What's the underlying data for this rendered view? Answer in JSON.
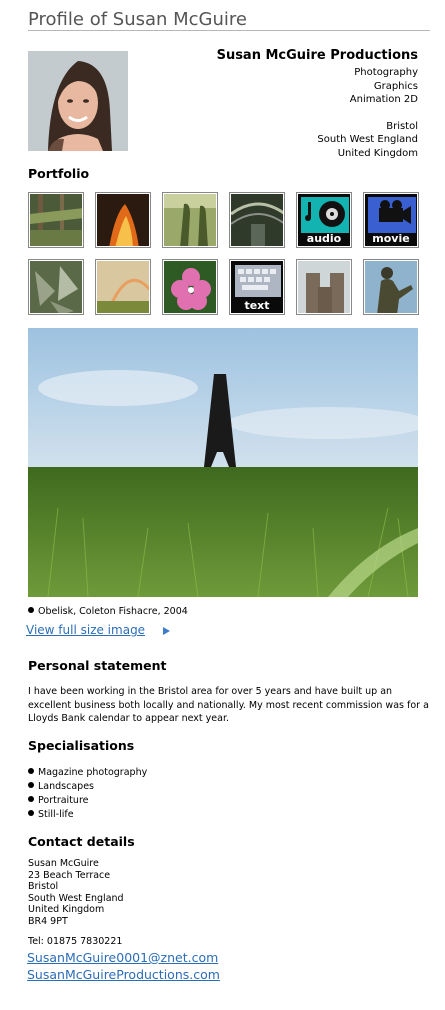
{
  "page": {
    "title": "Profile of Susan McGuire"
  },
  "company": {
    "name": "Susan McGuire Productions",
    "services": [
      "Photography",
      "Graphics",
      "Animation 2D"
    ],
    "location": [
      "Bristol",
      "South West England",
      "United Kingdom"
    ]
  },
  "portfolio": {
    "heading": "Portfolio",
    "thumb_labels": {
      "audio": "audio",
      "movie": "movie",
      "text": "text"
    }
  },
  "main_image": {
    "caption": "Obelisk, Coleton Fishacre, 2004",
    "view_full_link": "View full size image"
  },
  "statement": {
    "heading": "Personal statement",
    "text": "I have been working in the Bristol area for over 5 years and have built up an excellent business both locally and nationally. My most recent commission was for a Lloyds Bank calendar to appear next year."
  },
  "specialisations": {
    "heading": "Specialisations",
    "items": [
      "Magazine photography",
      "Landscapes",
      "Portraiture",
      "Still-life"
    ]
  },
  "contact": {
    "heading": "Contact details",
    "address": [
      "Susan McGuire",
      "23 Beach Terrace",
      "Bristol",
      "South West England",
      "United Kingdom",
      "BR4 9PT"
    ],
    "tel": "Tel: 01875 7830221",
    "email": "SusanMcGuire0001@znet.com",
    "website": "SusanMcGuireProductions.com"
  },
  "colors": {
    "link": "#2c6db8",
    "title": "#555555"
  }
}
